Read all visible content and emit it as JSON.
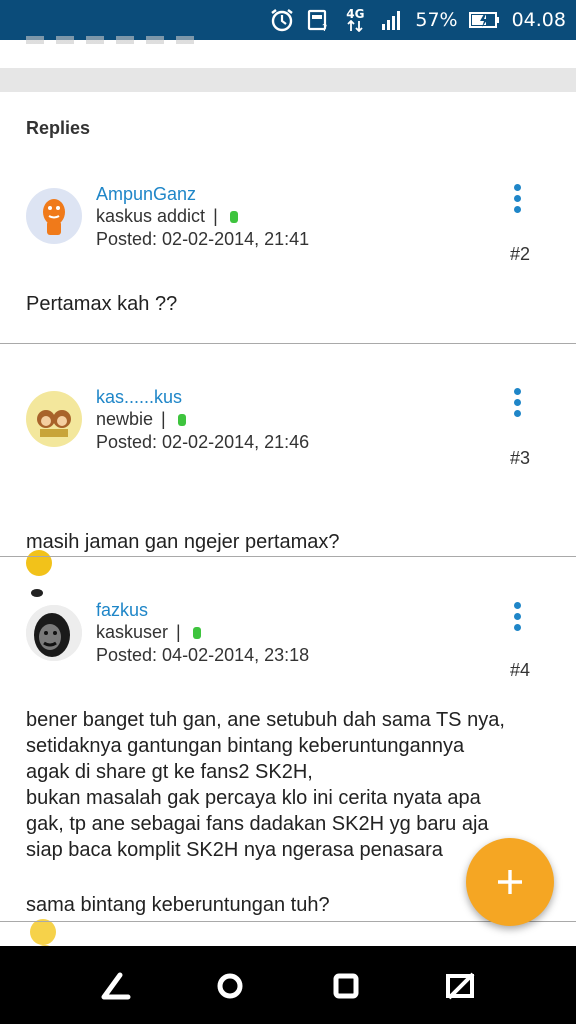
{
  "status_bar": {
    "network": "4G",
    "battery": "57%",
    "time": "04.08",
    "icons": [
      "alarm-icon",
      "data-saver-icon",
      "signal-icon",
      "battery-icon"
    ]
  },
  "replies_heading": "Replies",
  "posts": [
    {
      "username": "AmpunGanz",
      "rank": "kaskus addict",
      "separator": "|",
      "posted": "Posted: 02-02-2014, 21:41",
      "number": "#2",
      "content": "Pertamax kah ??",
      "online": true
    },
    {
      "username": "kas......kus",
      "rank": "newbie",
      "separator": "|",
      "posted": "Posted: 02-02-2014, 21:46",
      "number": "#3",
      "content": "masih jaman gan ngejer pertamax?",
      "online": true
    },
    {
      "username": "fazkus",
      "rank": "kaskuser",
      "separator": "|",
      "posted": "Posted: 04-02-2014, 23:18",
      "number": "#4",
      "content": "bener banget tuh gan, ane setubuh dah sama TS nya,\nsetidaknya gantungan bintang keberuntungannya\nagak di share gt ke fans2 SK2H,\nbukan masalah gak percaya klo ini cerita nyata apa\ngak, tp ane sebagai fans dadakan SK2H yg baru aja\nsiap baca komplit SK2H nya ngerasa penasara",
      "content_last_line": "sama bintang keberuntungan tuh?",
      "online": true
    }
  ],
  "colors": {
    "status_bar": "#0b4c7a",
    "accent": "#1f86c8",
    "fab": "#f5a623",
    "online": "#3ec43e"
  },
  "fab_icon": "plus-icon",
  "nav_icons": [
    "back-icon",
    "home-icon",
    "recents-icon",
    "hide-navbar-icon"
  ]
}
